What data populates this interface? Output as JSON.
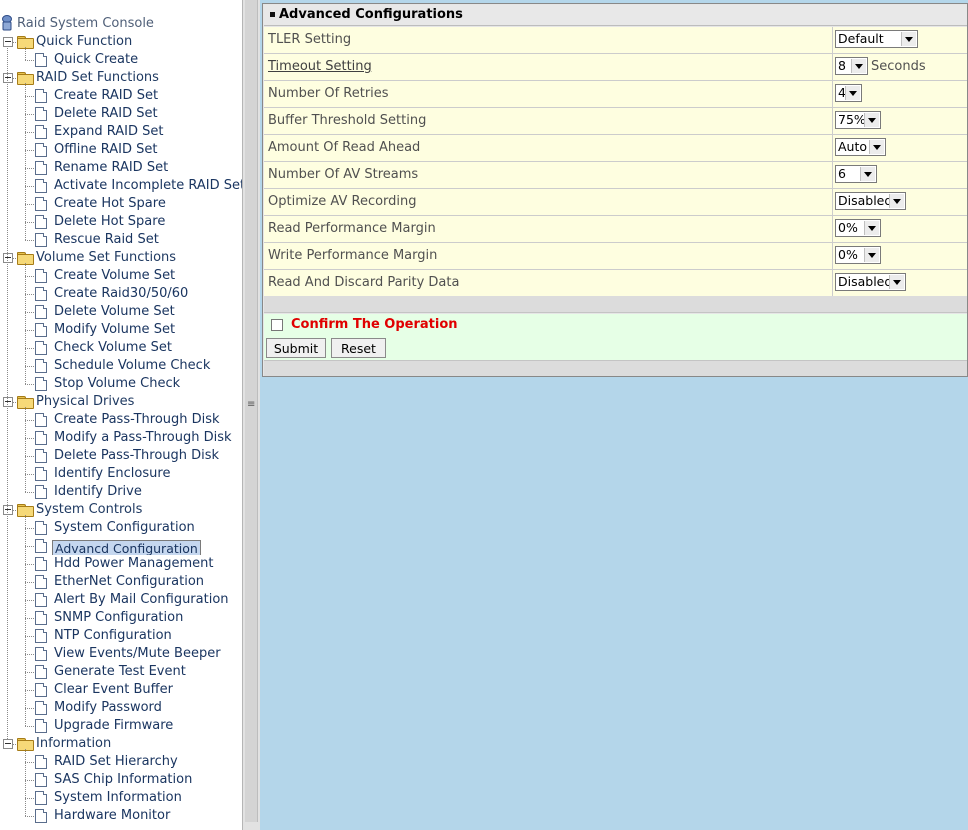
{
  "tree": {
    "root": "Raid System Console",
    "groups": [
      {
        "label": "Quick Function",
        "items": [
          "Quick Create"
        ]
      },
      {
        "label": "RAID Set Functions",
        "items": [
          "Create RAID Set",
          "Delete RAID Set",
          "Expand RAID Set",
          "Offline RAID Set",
          "Rename RAID Set",
          "Activate Incomplete RAID Set",
          "Create Hot Spare",
          "Delete Hot Spare",
          "Rescue Raid Set"
        ]
      },
      {
        "label": "Volume Set Functions",
        "items": [
          "Create Volume Set",
          "Create Raid30/50/60",
          "Delete Volume Set",
          "Modify Volume Set",
          "Check Volume Set",
          "Schedule Volume Check",
          "Stop Volume Check"
        ]
      },
      {
        "label": "Physical Drives",
        "items": [
          "Create Pass-Through Disk",
          "Modify a Pass-Through Disk",
          "Delete Pass-Through Disk",
          "Identify Enclosure",
          "Identify Drive"
        ]
      },
      {
        "label": "System Controls",
        "items": [
          "System Configuration",
          "Advancd Configuration",
          "Hdd Power Management",
          "EtherNet Configuration",
          "Alert By Mail Configuration",
          "SNMP Configuration",
          "NTP Configuration",
          "View Events/Mute Beeper",
          "Generate Test Event",
          "Clear Event Buffer",
          "Modify Password",
          "Upgrade Firmware"
        ]
      },
      {
        "label": "Information",
        "items": [
          "RAID Set Hierarchy",
          "SAS Chip Information",
          "System Information",
          "Hardware Monitor"
        ]
      }
    ],
    "selected": "Advancd Configuration"
  },
  "panel": {
    "title": "Advanced Configurations",
    "rows": [
      {
        "label": "TLER Setting",
        "value": "Default"
      },
      {
        "label": "Timeout Setting",
        "value": "8",
        "unit": "Seconds",
        "link": true
      },
      {
        "label": "Number Of Retries",
        "value": "4"
      },
      {
        "label": "Buffer Threshold Setting",
        "value": "75%"
      },
      {
        "label": "Amount Of Read Ahead",
        "value": "Auto"
      },
      {
        "label": "Number Of AV Streams",
        "value": "6"
      },
      {
        "label": "Optimize AV Recording",
        "value": "Disabled"
      },
      {
        "label": "Read Performance Margin",
        "value": "0%"
      },
      {
        "label": "Write Performance Margin",
        "value": "0%"
      },
      {
        "label": "Read And Discard Parity Data",
        "value": "Disabled"
      }
    ],
    "confirm_label": "Confirm The Operation",
    "submit_label": "Submit",
    "reset_label": "Reset"
  }
}
